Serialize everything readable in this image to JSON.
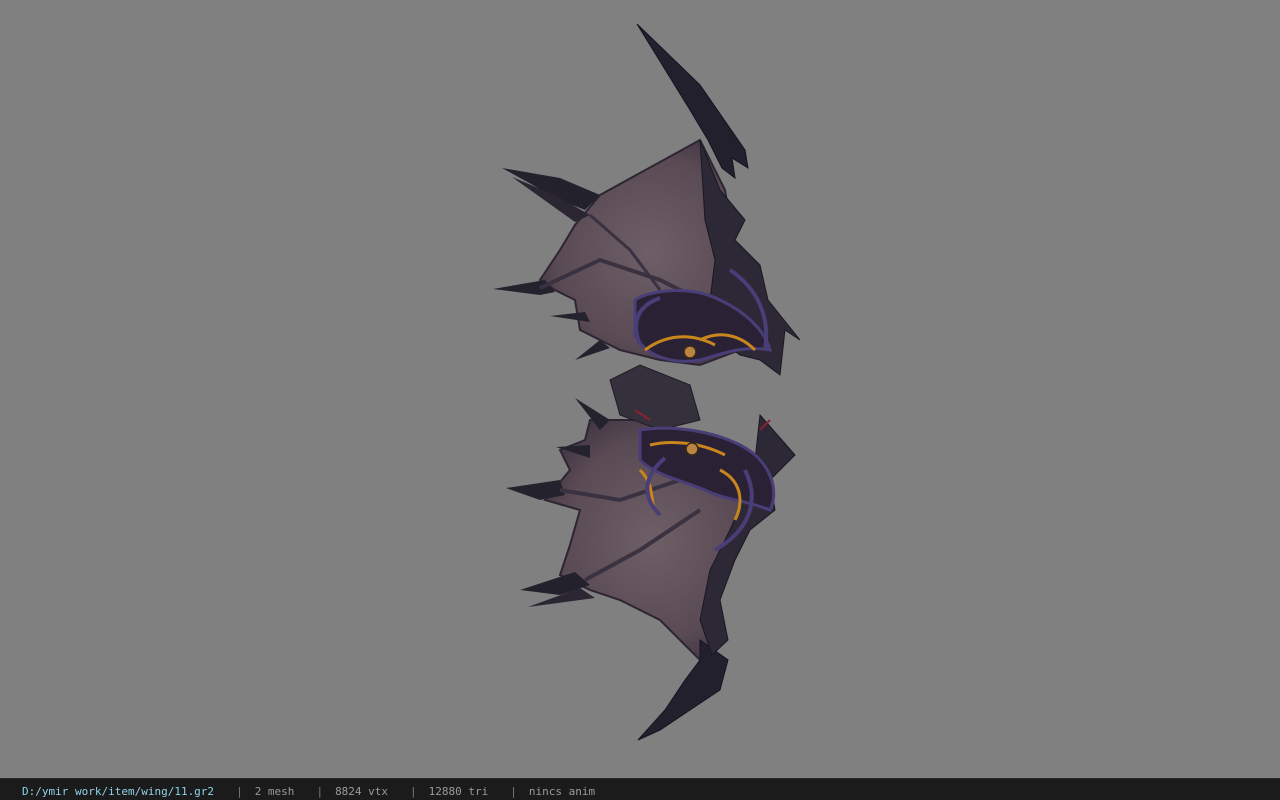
{
  "viewport": {
    "background_color": "#808080",
    "model": {
      "subject": "dark bat-like wing pair",
      "membrane_color": "#5f5058",
      "bone_color": "#2a2630",
      "spike_color": "#1c1a24",
      "accent_orange": "#c8861c",
      "accent_purple": "#4a3e78",
      "accent_red": "#8a2232"
    }
  },
  "statusbar": {
    "file_path": "D:/ymir work/item/wing/11.gr2",
    "separator": "|",
    "mesh_count": "2 mesh",
    "vertex_count": "8824 vtx",
    "triangle_count": "12880 tri",
    "animation": "nincs anim",
    "path_color": "#8fd2e8",
    "background_color": "#1b1b1b"
  }
}
